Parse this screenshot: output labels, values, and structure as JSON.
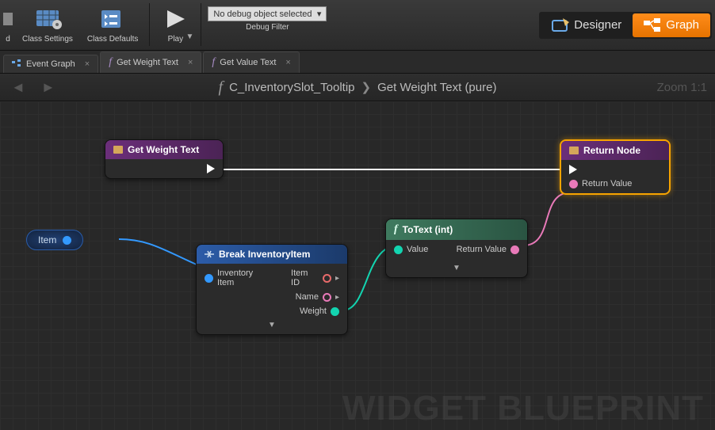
{
  "toolbar": {
    "class_settings": "Class Settings",
    "class_defaults": "Class Defaults",
    "play": "Play",
    "debug_select": "No debug object selected",
    "debug_label": "Debug Filter",
    "designer": "Designer",
    "graph": "Graph"
  },
  "tabs": {
    "event_graph": "Event Graph",
    "get_weight": "Get Weight Text",
    "get_value": "Get Value Text"
  },
  "breadcrumb": {
    "root": "C_InventorySlot_Tooltip",
    "func": "Get Weight Text (pure)",
    "zoom": "Zoom 1:1"
  },
  "nodes": {
    "entry": {
      "title": "Get Weight Text"
    },
    "ret": {
      "title": "Return Node",
      "ret_val": "Return Value"
    },
    "var": {
      "name": "Item"
    },
    "break": {
      "title": "Break InventoryItem",
      "in": "Inventory Item",
      "out1": "Item ID",
      "out2": "Name",
      "out3": "Weight"
    },
    "totext": {
      "title": "ToText (int)",
      "in": "Value",
      "out": "Return Value"
    }
  },
  "watermark": "WIDGET BLUEPRINT"
}
